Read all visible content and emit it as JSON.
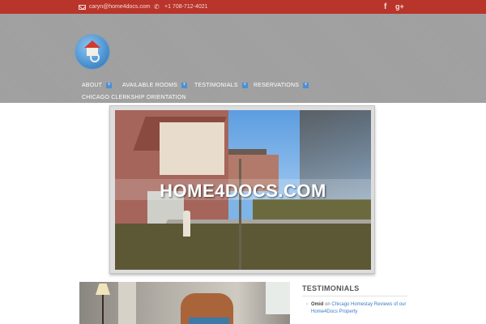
{
  "topbar": {
    "email": "caryn@home4docs.com",
    "phone": "+1 708-712-4021",
    "social": [
      {
        "label": "f",
        "icon": "facebook-icon"
      },
      {
        "label": "g+",
        "icon": "google-plus-icon"
      }
    ],
    "colors": {
      "background": "#b9342a"
    }
  },
  "nav": {
    "items": [
      {
        "label": "ABOUT",
        "has_submenu": true
      },
      {
        "label": "AVAILABLE ROOMS",
        "has_submenu": true
      },
      {
        "label": "TESTIMONIALS",
        "has_submenu": true
      },
      {
        "label": "RESERVATIONS",
        "has_submenu": true
      },
      {
        "label": "CHICAGO CLERKSHIP ORIENTATION",
        "has_submenu": false
      }
    ],
    "submenu_glyph": "+",
    "colors": {
      "submenu_badge": "#4b8fd6"
    }
  },
  "slider": {
    "caption": "HOME4DOCS.COM"
  },
  "sidebar": {
    "title": "TESTIMONIALS",
    "entries": [
      {
        "author": "Omid",
        "connector": "on",
        "link_text": "Chicago Homestay Reviews of our Home4Docs Property"
      }
    ]
  }
}
